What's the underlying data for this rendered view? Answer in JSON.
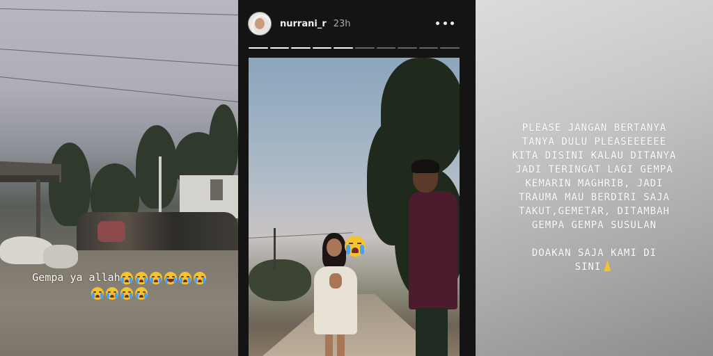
{
  "left_story": {
    "caption_text": "Gempa ya allah",
    "caption_emoji_row1": [
      "loudly-crying-face",
      "loudly-crying-face",
      "loudly-crying-face",
      "face-with-tears-of-joy",
      "loudly-crying-face",
      "loudly-crying-face"
    ],
    "caption_emoji_row2": [
      "loudly-crying-face",
      "loudly-crying-face",
      "loudly-crying-face",
      "loudly-crying-face"
    ]
  },
  "middle_story": {
    "username": "nurrani_r",
    "timestamp": "23h",
    "progress": {
      "segments": 10,
      "completed": 5
    },
    "sticker": "loudly-crying-face"
  },
  "right_story": {
    "line1": "PLEASE JANGAN BERTANYA",
    "line2": "TANYA DULU PLEASEEEEEE",
    "line3": "KITA DISINI KALAU DITANYA",
    "line4": "JADI TERINGAT LAGI GEMPA",
    "line5": "KEMARIN MAGHRIB, JADI",
    "line6": "TRAUMA MAU BERDIRI SAJA",
    "line7": "TAKUT,GEMETAR, DITAMBAH",
    "line8": "GEMPA GEMPA SUSULAN",
    "line9": "DOAKAN SAJA KAMI DI",
    "line10": "SINI",
    "end_icon": "folded-hands"
  }
}
